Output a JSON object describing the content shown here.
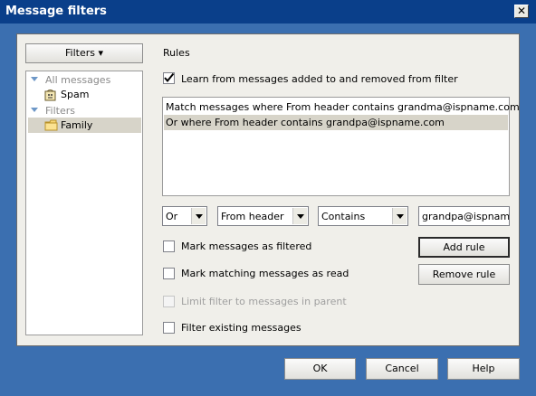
{
  "window": {
    "title": "Message filters",
    "close_glyph": "✕"
  },
  "sidebar": {
    "filters_button": "Filters ▾",
    "tree": {
      "all_messages": "All messages",
      "spam": "Spam",
      "filters_group": "Filters",
      "family": "Family"
    }
  },
  "main": {
    "rules_label": "Rules",
    "learn": {
      "label": "Learn from messages added to and removed from filter",
      "checked": true
    },
    "rules": [
      "Match messages where From header contains grandma@ispname.com",
      "Or where From header contains grandpa@ispname.com"
    ],
    "selected_rule_index": 1,
    "operator": "Or",
    "header_field": "From header",
    "match_type": "Contains",
    "match_value": "grandpa@ispname.com",
    "add_rule": "Add rule",
    "remove_rule": "Remove rule",
    "options": {
      "mark_filtered": "Mark messages as filtered",
      "mark_read": "Mark matching messages as read",
      "limit_parent": "Limit filter to messages in parent",
      "filter_existing": "Filter existing messages"
    }
  },
  "footer": {
    "ok": "OK",
    "cancel": "Cancel",
    "help": "Help"
  },
  "icons": {
    "spam": "spam-icon",
    "folder": "folder-icon",
    "check": "checkmark-icon"
  }
}
